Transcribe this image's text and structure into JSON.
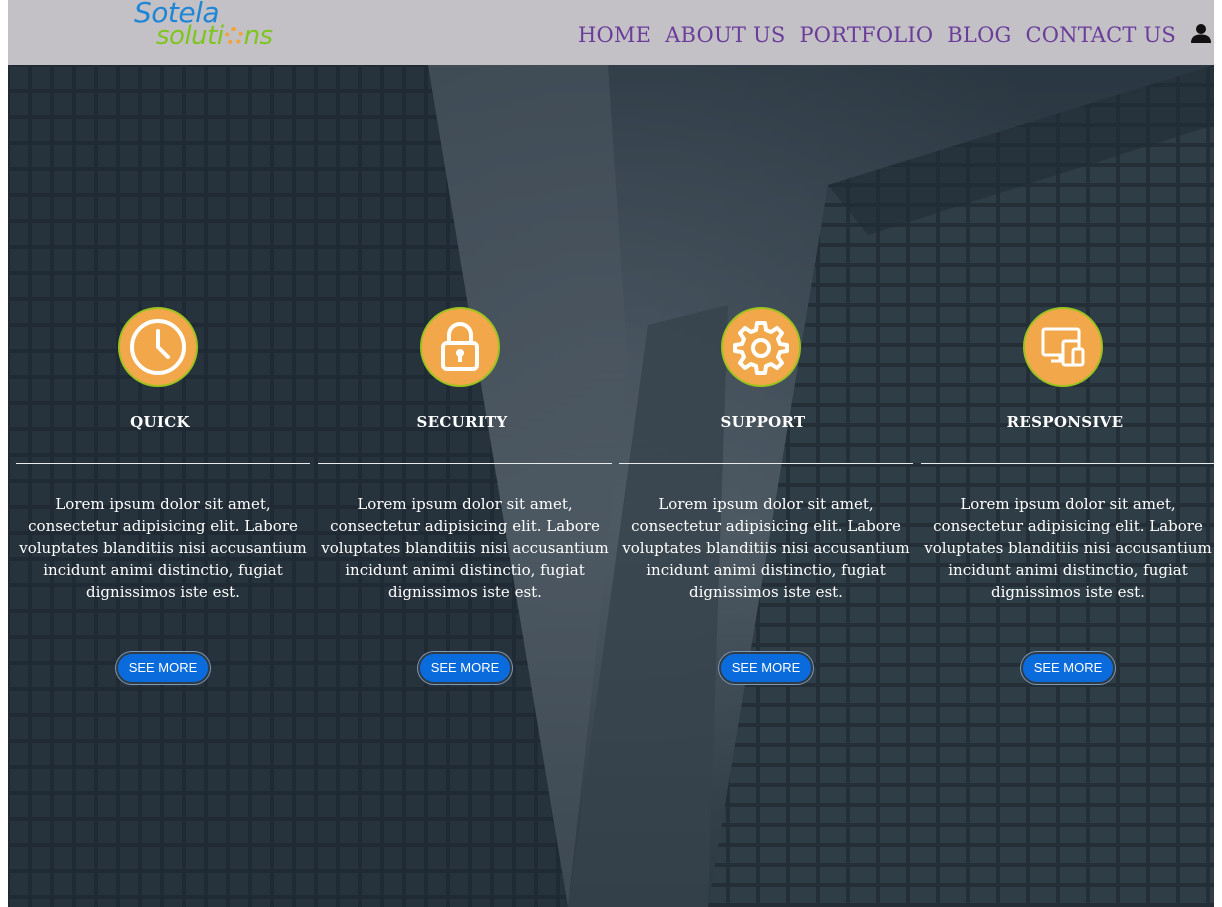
{
  "header": {
    "logo": {
      "line1": "Sotela",
      "line2_a": "soluti",
      "line2_b": "ns"
    },
    "nav": [
      "HOME",
      "ABOUT US",
      "PORTFOLIO",
      "BLOG",
      "CONTACT US"
    ],
    "user_icon": "user-icon"
  },
  "features": [
    {
      "icon": "clock-icon",
      "title": "QUICK",
      "text": "Lorem ipsum dolor sit amet, consectetur adipisicing elit. Labore voluptates blanditiis nisi accusantium incidunt animi distinctio, fugiat dignissimos iste est.",
      "button": "SEE MORE"
    },
    {
      "icon": "padlock-icon",
      "title": "SECURITY",
      "text": "Lorem ipsum dolor sit amet, consectetur adipisicing elit. Labore voluptates blanditiis nisi accusantium incidunt animi distinctio, fugiat dignissimos iste est.",
      "button": "SEE MORE"
    },
    {
      "icon": "gear-icon",
      "title": "SUPPORT",
      "text": "Lorem ipsum dolor sit amet, consectetur adipisicing elit. Labore voluptates blanditiis nisi accusantium incidunt animi distinctio, fugiat dignissimos iste est.",
      "button": "SEE MORE"
    },
    {
      "icon": "devices-icon",
      "title": "RESPONSIVE",
      "text": "Lorem ipsum dolor sit amet, consectetur adipisicing elit. Labore voluptates blanditiis nisi accusantium incidunt animi distinctio, fugiat dignissimos iste est.",
      "button": "SEE MORE"
    }
  ],
  "colors": {
    "header_bg": "#c3c0c6",
    "nav_text": "#6a3d9a",
    "logo_blue": "#1f86d6",
    "logo_green": "#7fc51f",
    "icon_orange": "#f2a84a",
    "button_blue": "#0a6bdc"
  }
}
